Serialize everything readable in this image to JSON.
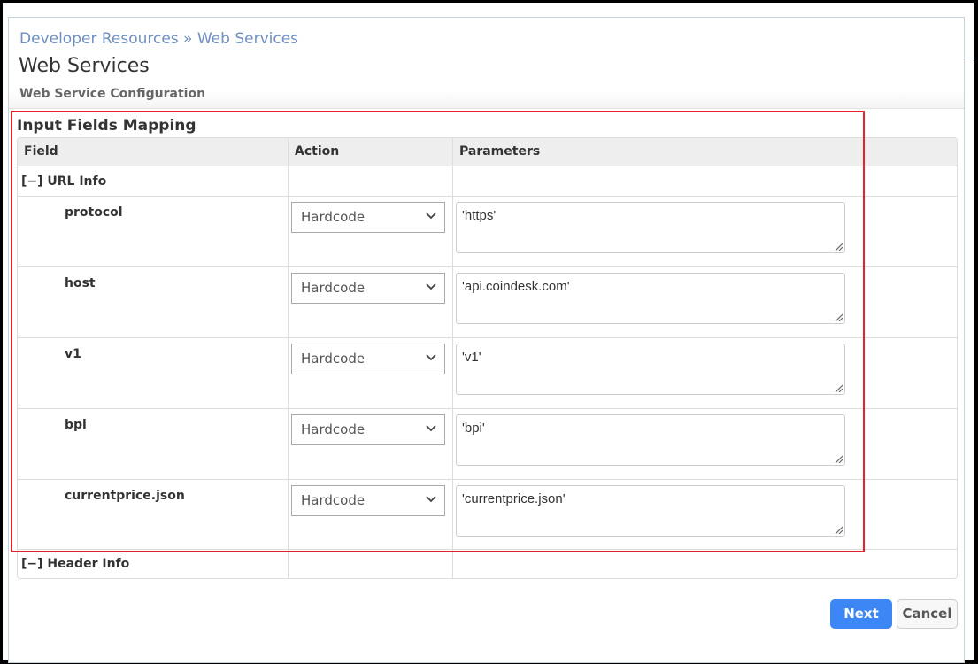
{
  "breadcrumb": "Developer Resources » Web Services",
  "page_title": "Web Services",
  "subtitle": "Web Service Configuration",
  "section_title": "Input Fields Mapping",
  "columns": [
    "Field",
    "Action",
    "Parameters"
  ],
  "groups": [
    {
      "label": "[−] URL Info"
    },
    {
      "label": "[−] Header Info"
    }
  ],
  "rows": [
    {
      "field": "protocol",
      "action": "Hardcode",
      "parameter": "'https'"
    },
    {
      "field": "host",
      "action": "Hardcode",
      "parameter": "'api.coindesk.com'"
    },
    {
      "field": "v1",
      "action": "Hardcode",
      "parameter": "'v1'"
    },
    {
      "field": "bpi",
      "action": "Hardcode",
      "parameter": "'bpi'"
    },
    {
      "field": "currentprice.json",
      "action": "Hardcode",
      "parameter": "'currentprice.json'"
    }
  ],
  "buttons": {
    "next": "Next",
    "cancel": "Cancel"
  },
  "colors": {
    "accent": "#3d86f5",
    "highlight": "#e8202a",
    "breadcrumb": "#6f8fc0"
  }
}
